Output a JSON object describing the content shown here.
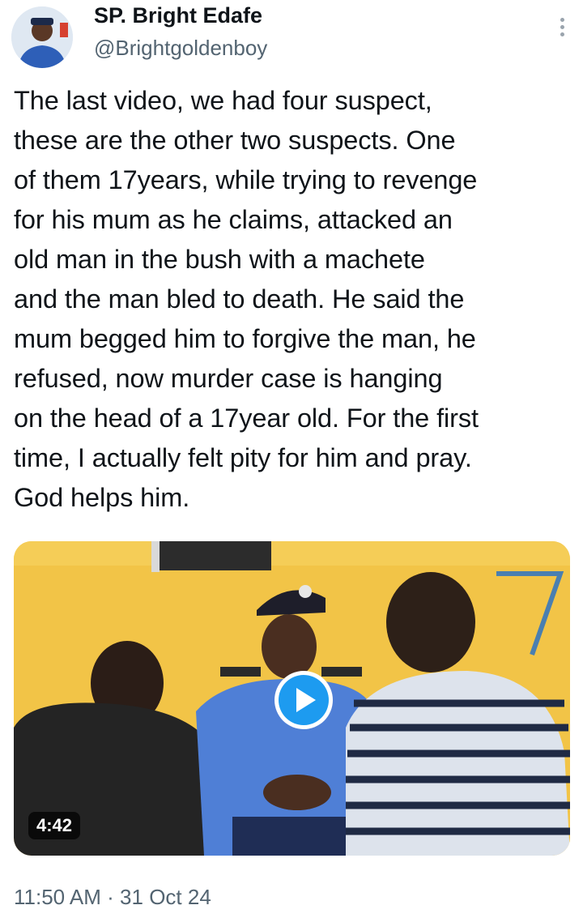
{
  "author": {
    "name": "SP. Bright Edafe",
    "handle": "@Brightgoldenboy"
  },
  "tweet": {
    "text": "The last video, we had four suspect,\nthese are the other two suspects. One\nof them 17years, while trying to revenge\nfor his mum as he claims, attacked an\nold man in the bush with a machete\nand the man bled to death. He said the\nmum begged him to forgive the man, he\nrefused, now murder case is hanging\non the head of a 17year old. For the first\ntime, I actually felt pity for him and pray.\nGod helps him."
  },
  "media": {
    "duration": "4:42",
    "play_icon": "play-icon"
  },
  "meta": {
    "time": "11:50 AM",
    "separator": " · ",
    "date": "31 Oct 24"
  },
  "colors": {
    "accent": "#1d9bf0",
    "secondary_text": "#536471",
    "wall": "#f2c447"
  }
}
